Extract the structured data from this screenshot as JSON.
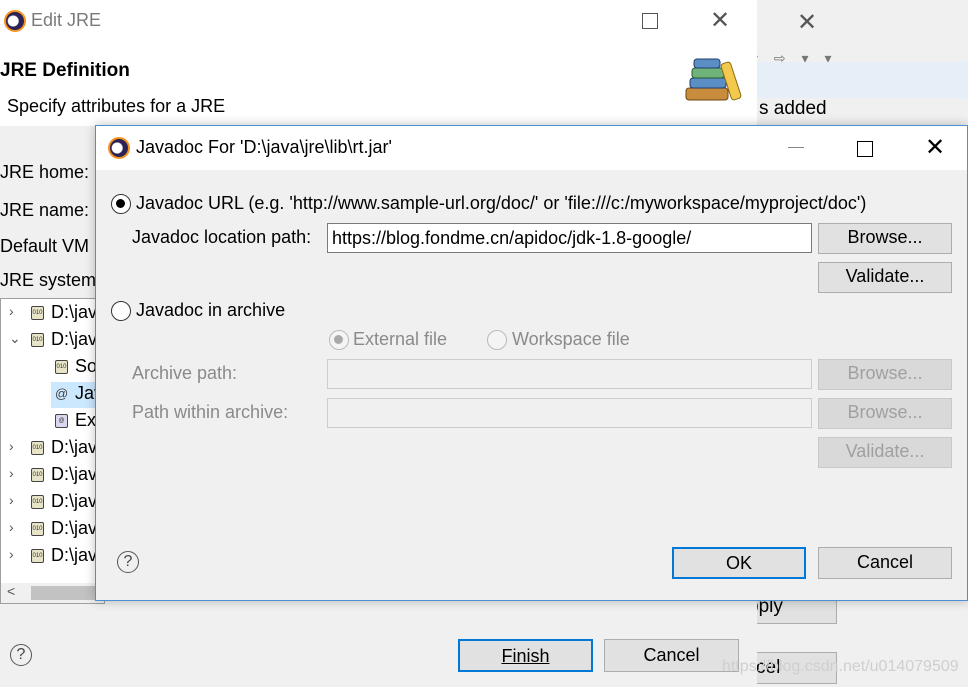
{
  "background_window": {
    "added_text": "s added",
    "apply_label": "pply",
    "cancel_label": "cel"
  },
  "edit_jre": {
    "title": "Edit JRE",
    "heading": "JRE Definition",
    "subheading": "Specify attributes for a JRE",
    "jre_home_label": "JRE home:",
    "jre_name_label": "JRE name:",
    "default_vm_label": "Default VM",
    "jre_system_label": "JRE system",
    "tree": [
      {
        "text": "D:\\jav",
        "expander": "›"
      },
      {
        "text": "D:\\jav",
        "expander": "⌄"
      },
      {
        "text": "So",
        "expander": ""
      },
      {
        "text": "Jav",
        "expander": ""
      },
      {
        "text": "Ex",
        "expander": ""
      },
      {
        "text": "D:\\jav",
        "expander": "›"
      },
      {
        "text": "D:\\jav",
        "expander": "›"
      },
      {
        "text": "D:\\jav",
        "expander": "›"
      },
      {
        "text": "D:\\jav",
        "expander": "›"
      },
      {
        "text": "D:\\jav",
        "expander": "›"
      }
    ],
    "finish_label": "Finish",
    "cancel_label": "Cancel",
    "help_symbol": "?"
  },
  "javadoc_dialog": {
    "title": "Javadoc For 'D:\\java\\jre\\lib\\rt.jar'",
    "url_option_label": "Javadoc URL (e.g. 'http://www.sample-url.org/doc/' or 'file:///c:/myworkspace/myproject/doc')",
    "location_label": "Javadoc location path:",
    "location_value": "https://blog.fondme.cn/apidoc/jdk-1.8-google/",
    "browse_label": "Browse...",
    "validate_label": "Validate...",
    "archive_option_label": "Javadoc in archive",
    "external_file_label": "External file",
    "workspace_file_label": "Workspace file",
    "archive_path_label": "Archive path:",
    "archive_path_value": "",
    "path_within_label": "Path within archive:",
    "path_within_value": "",
    "ok_label": "OK",
    "cancel_label": "Cancel",
    "help_symbol": "?"
  },
  "watermark": "https://blog.csdn.net/u014079509"
}
